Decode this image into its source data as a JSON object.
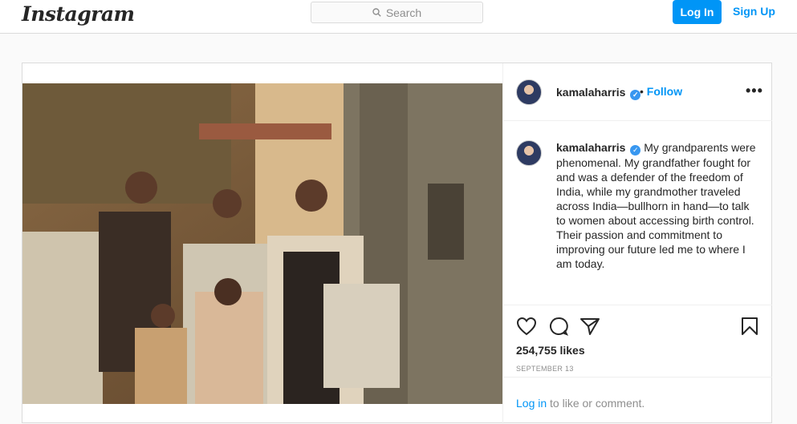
{
  "topbar": {
    "logo": "Instagram",
    "search_placeholder": "Search",
    "login_label": "Log In",
    "signup_label": "Sign Up"
  },
  "post": {
    "username": "kamalaharris",
    "follow_label": "Follow",
    "separator": "•",
    "more_label": "•••",
    "caption": "My grandparents were phenomenal. My grandfather fought for and was a defender of the freedom of India, while my grandmother traveled across India—bullhorn in hand—to talk to women about accessing birth control. Their passion and commitment to improving our future led me to where I am today.",
    "likes": "254,755 likes",
    "date": "SEPTEMBER 13",
    "login_link": "Log in",
    "login_suffix": " to like or comment."
  },
  "icons": {
    "search": "search-icon",
    "verified": "verified-badge-icon",
    "like": "heart-icon",
    "comment": "comment-icon",
    "share": "share-icon",
    "save": "bookmark-icon"
  },
  "colors": {
    "accent": "#0095f6",
    "verified": "#3897f0",
    "border": "#dbdbdb"
  }
}
